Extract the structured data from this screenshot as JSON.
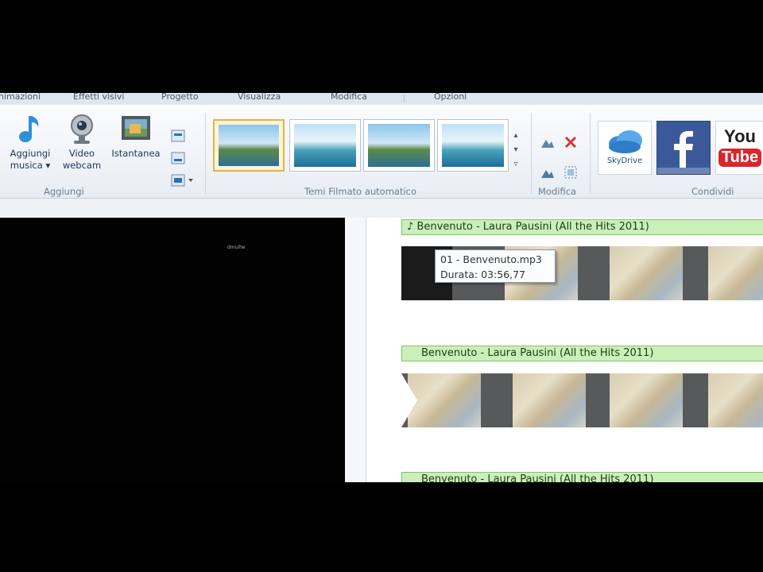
{
  "ribbon": {
    "tabs": [
      "nimazioni",
      "Effetti visivi",
      "Progetto",
      "Visualizza",
      "Modifica",
      "Opzioni"
    ],
    "groups": {
      "aggiungi": {
        "label": "Aggiungi",
        "buttons": [
          {
            "line1": "Aggiungi",
            "line2": "musica ▾",
            "icon": "music-note-icon"
          },
          {
            "line1": "Video",
            "line2": "webcam",
            "icon": "webcam-icon"
          },
          {
            "line1": "Istantanea",
            "line2": "",
            "icon": "snapshot-icon"
          }
        ]
      },
      "temi": {
        "label": "Temi Filmato automatico",
        "themes": 4
      },
      "modifica": {
        "label": "Modifica"
      },
      "condividi": {
        "label": "Condividi",
        "skydrive": "SkyDrive",
        "youtube_line1": "You",
        "youtube_line2": "Tube"
      }
    }
  },
  "preview": {
    "text": "dmulhe"
  },
  "timeline": {
    "audio_tracks": [
      {
        "title": "♪ Benvenuto - Laura Pausini (All the Hits 2011)"
      },
      {
        "title": "Benvenuto - Laura Pausini (All the Hits 2011)"
      },
      {
        "title": "Benvenuto - Laura Pausini (All the Hits 2011)"
      }
    ],
    "tooltip": {
      "line1": "01 - Benvenuto.mp3",
      "line2": "Durata: 03:56,77"
    }
  },
  "colors": {
    "audio_bar": "#c9f0b9",
    "selected_theme": "#e0b44a",
    "facebook": "#3b5998",
    "youtube": "#d8262c"
  }
}
